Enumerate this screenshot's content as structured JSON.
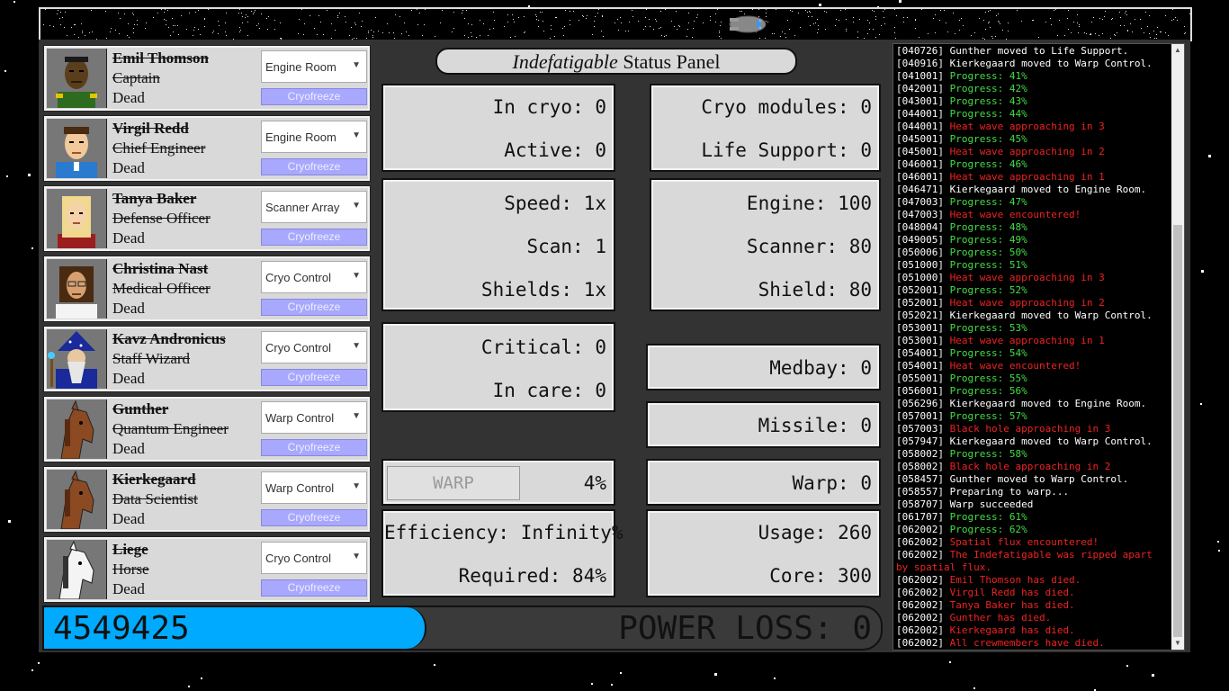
{
  "ship": {
    "name": "Indefatigable",
    "panel_suffix": "Status Panel"
  },
  "crew": [
    {
      "name": "Emil Thomson",
      "role": "Captain",
      "status": "Dead",
      "location": "Engine Room",
      "action": "Cryofreeze",
      "portrait": "captain-portrait"
    },
    {
      "name": "Virgil Redd",
      "role": "Chief Engineer",
      "status": "Dead",
      "location": "Engine Room",
      "action": "Cryofreeze",
      "portrait": "engineer-portrait"
    },
    {
      "name": "Tanya Baker",
      "role": "Defense Officer",
      "status": "Dead",
      "location": "Scanner Array",
      "action": "Cryofreeze",
      "portrait": "defense-officer-portrait"
    },
    {
      "name": "Christina Nast",
      "role": "Medical Officer",
      "status": "Dead",
      "location": "Cryo Control",
      "action": "Cryofreeze",
      "portrait": "medical-officer-portrait"
    },
    {
      "name": "Kavz Andronicus",
      "role": "Staff Wizard",
      "status": "Dead",
      "location": "Cryo Control",
      "action": "Cryofreeze",
      "portrait": "wizard-portrait"
    },
    {
      "name": "Gunther",
      "role": "Quantum Engineer",
      "status": "Dead",
      "location": "Warp Control",
      "action": "Cryofreeze",
      "portrait": "horse-portrait"
    },
    {
      "name": "Kierkegaard",
      "role": "Data Scientist",
      "status": "Dead",
      "location": "Warp Control",
      "action": "Cryofreeze",
      "portrait": "horse-portrait"
    },
    {
      "name": "Liege",
      "role": "Horse",
      "status": "Dead",
      "location": "Cryo Control",
      "action": "Cryofreeze",
      "portrait": "white-horse-portrait"
    }
  ],
  "status": {
    "in_cryo": "In cryo: 0",
    "active": "Active: 0",
    "cryo_modules": "Cryo modules: 0",
    "life_support": "Life Support: 0",
    "speed": "Speed: 1x",
    "scan": "Scan: 1",
    "shields": "Shields: 1x",
    "engine": "Engine: 100",
    "scanner": "Scanner: 80",
    "shield": "Shield: 80",
    "critical": "Critical: 0",
    "in_care": "In care: 0",
    "medbay": "Medbay: 0",
    "missile": "Missile: 0",
    "warp_button": "WARP",
    "warp_progress": "4%",
    "warp": "Warp: 0",
    "efficiency": "Efficiency: Infinity%",
    "required": "Required: 84%",
    "usage": "Usage: 260",
    "core": "Core: 300"
  },
  "score": {
    "value": "4549425",
    "fill_fraction": 0.455
  },
  "power_loss": "POWER LOSS: 0",
  "log": [
    {
      "t": "[040726]",
      "m": "Gunther moved to Life Support.",
      "c": "white"
    },
    {
      "t": "[040916]",
      "m": "Kierkegaard moved to Warp Control.",
      "c": "white"
    },
    {
      "t": "[041001]",
      "m": "Progress: 41%",
      "c": "green"
    },
    {
      "t": "[042001]",
      "m": "Progress: 42%",
      "c": "green"
    },
    {
      "t": "[043001]",
      "m": "Progress: 43%",
      "c": "green"
    },
    {
      "t": "[044001]",
      "m": "Progress: 44%",
      "c": "green"
    },
    {
      "t": "[044001]",
      "m": "Heat wave approaching in 3",
      "c": "red"
    },
    {
      "t": "[045001]",
      "m": "Progress: 45%",
      "c": "green"
    },
    {
      "t": "[045001]",
      "m": "Heat wave approaching in 2",
      "c": "red"
    },
    {
      "t": "[046001]",
      "m": "Progress: 46%",
      "c": "green"
    },
    {
      "t": "[046001]",
      "m": "Heat wave approaching in 1",
      "c": "red"
    },
    {
      "t": "[046471]",
      "m": "Kierkegaard moved to Engine Room.",
      "c": "white"
    },
    {
      "t": "[047003]",
      "m": "Progress: 47%",
      "c": "green"
    },
    {
      "t": "[047003]",
      "m": "Heat wave encountered!",
      "c": "red"
    },
    {
      "t": "[048004]",
      "m": "Progress: 48%",
      "c": "green"
    },
    {
      "t": "[049005]",
      "m": "Progress: 49%",
      "c": "green"
    },
    {
      "t": "[050006]",
      "m": "Progress: 50%",
      "c": "green"
    },
    {
      "t": "[051000]",
      "m": "Progress: 51%",
      "c": "green"
    },
    {
      "t": "[051000]",
      "m": "Heat wave approaching in 3",
      "c": "red"
    },
    {
      "t": "[052001]",
      "m": "Progress: 52%",
      "c": "green"
    },
    {
      "t": "[052001]",
      "m": "Heat wave approaching in 2",
      "c": "red"
    },
    {
      "t": "[052021]",
      "m": "Kierkegaard moved to Warp Control.",
      "c": "white"
    },
    {
      "t": "[053001]",
      "m": "Progress: 53%",
      "c": "green"
    },
    {
      "t": "[053001]",
      "m": "Heat wave approaching in 1",
      "c": "red"
    },
    {
      "t": "[054001]",
      "m": "Progress: 54%",
      "c": "green"
    },
    {
      "t": "[054001]",
      "m": "Heat wave encountered!",
      "c": "red"
    },
    {
      "t": "[055001]",
      "m": "Progress: 55%",
      "c": "green"
    },
    {
      "t": "[056001]",
      "m": "Progress: 56%",
      "c": "green"
    },
    {
      "t": "[056296]",
      "m": "Kierkegaard moved to Engine Room.",
      "c": "white"
    },
    {
      "t": "[057001]",
      "m": "Progress: 57%",
      "c": "green"
    },
    {
      "t": "[057003]",
      "m": "Black hole approaching in 3",
      "c": "red"
    },
    {
      "t": "[057947]",
      "m": "Kierkegaard moved to Warp Control.",
      "c": "white"
    },
    {
      "t": "[058002]",
      "m": "Progress: 58%",
      "c": "green"
    },
    {
      "t": "[058002]",
      "m": "Black hole approaching in 2",
      "c": "red"
    },
    {
      "t": "[058457]",
      "m": "Gunther moved to Warp Control.",
      "c": "white"
    },
    {
      "t": "[058557]",
      "m": "Preparing to warp...",
      "c": "white"
    },
    {
      "t": "[058707]",
      "m": "Warp succeeded",
      "c": "white"
    },
    {
      "t": "[061707]",
      "m": "Progress: 61%",
      "c": "green"
    },
    {
      "t": "[062002]",
      "m": "Progress: 62%",
      "c": "green"
    },
    {
      "t": "[062002]",
      "m": "Spatial flux encountered!",
      "c": "red"
    },
    {
      "t": "[062002]",
      "m": "The Indefatigable was ripped apart",
      "c": "red"
    },
    {
      "t": "",
      "m": "by spatial flux.",
      "c": "red"
    },
    {
      "t": "[062002]",
      "m": "Emil Thomson has died.",
      "c": "red"
    },
    {
      "t": "[062002]",
      "m": "Virgil Redd has died.",
      "c": "red"
    },
    {
      "t": "[062002]",
      "m": "Tanya Baker has died.",
      "c": "red"
    },
    {
      "t": "[062002]",
      "m": "Gunther has died.",
      "c": "red"
    },
    {
      "t": "[062002]",
      "m": "Kierkegaard has died.",
      "c": "red"
    },
    {
      "t": "[062002]",
      "m": "All crewmembers have died.",
      "c": "red"
    }
  ],
  "log_scroll": {
    "position_fraction": 1.0,
    "visible_fraction": 0.71
  },
  "colors": {
    "score_fill": "#00aaff",
    "cryo_button": "#a8a8ff",
    "log_green": "#44dd44",
    "log_red": "#ee2222"
  }
}
